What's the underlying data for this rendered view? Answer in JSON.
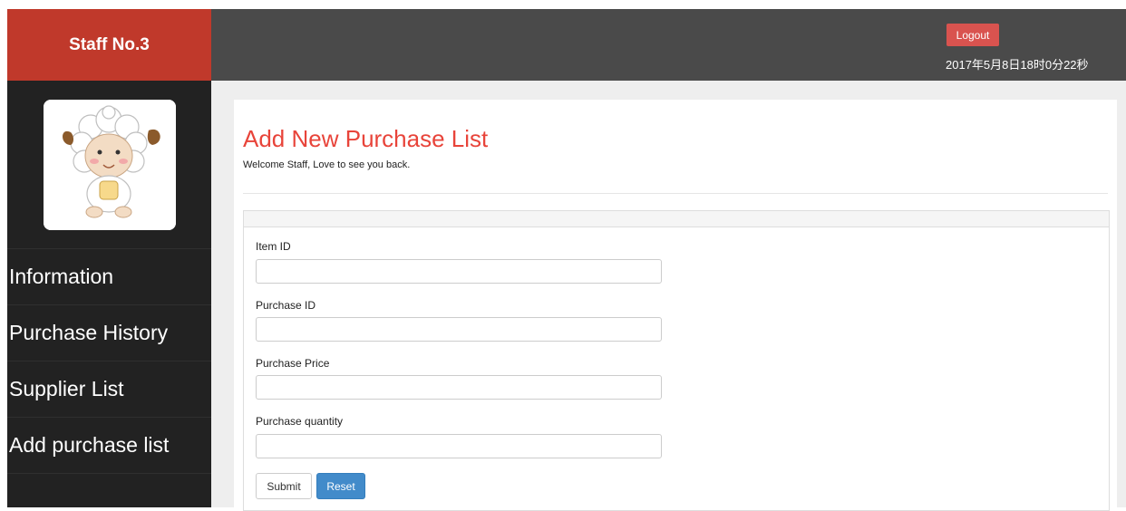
{
  "sidebar": {
    "brand": "Staff No.3",
    "nav": [
      {
        "label": "Information"
      },
      {
        "label": "Purchase History"
      },
      {
        "label": "Supplier List"
      },
      {
        "label": "Add purchase list"
      }
    ]
  },
  "header": {
    "logout_label": "Logout",
    "datetime": "2017年5月8日18时0分22秒"
  },
  "main": {
    "title": "Add New Purchase List",
    "welcome": "Welcome Staff, Love to see you back.",
    "form": {
      "fields": [
        {
          "label": "Item ID",
          "value": "",
          "placeholder": ""
        },
        {
          "label": "Purchase ID",
          "value": "",
          "placeholder": ""
        },
        {
          "label": "Purchase Price",
          "value": "",
          "placeholder": ""
        },
        {
          "label": "Purchase quantity",
          "value": "",
          "placeholder": ""
        }
      ],
      "submit_label": "Submit",
      "reset_label": "Reset"
    }
  },
  "colors": {
    "brand_red": "#c0392b",
    "sidebar_bg": "#222222",
    "topbar_bg": "#4a4a4a",
    "title_red": "#e8443a",
    "logout_red": "#d9534f",
    "primary_blue": "#428bca"
  },
  "icons": {
    "avatar": "sheep-avatar-icon"
  }
}
